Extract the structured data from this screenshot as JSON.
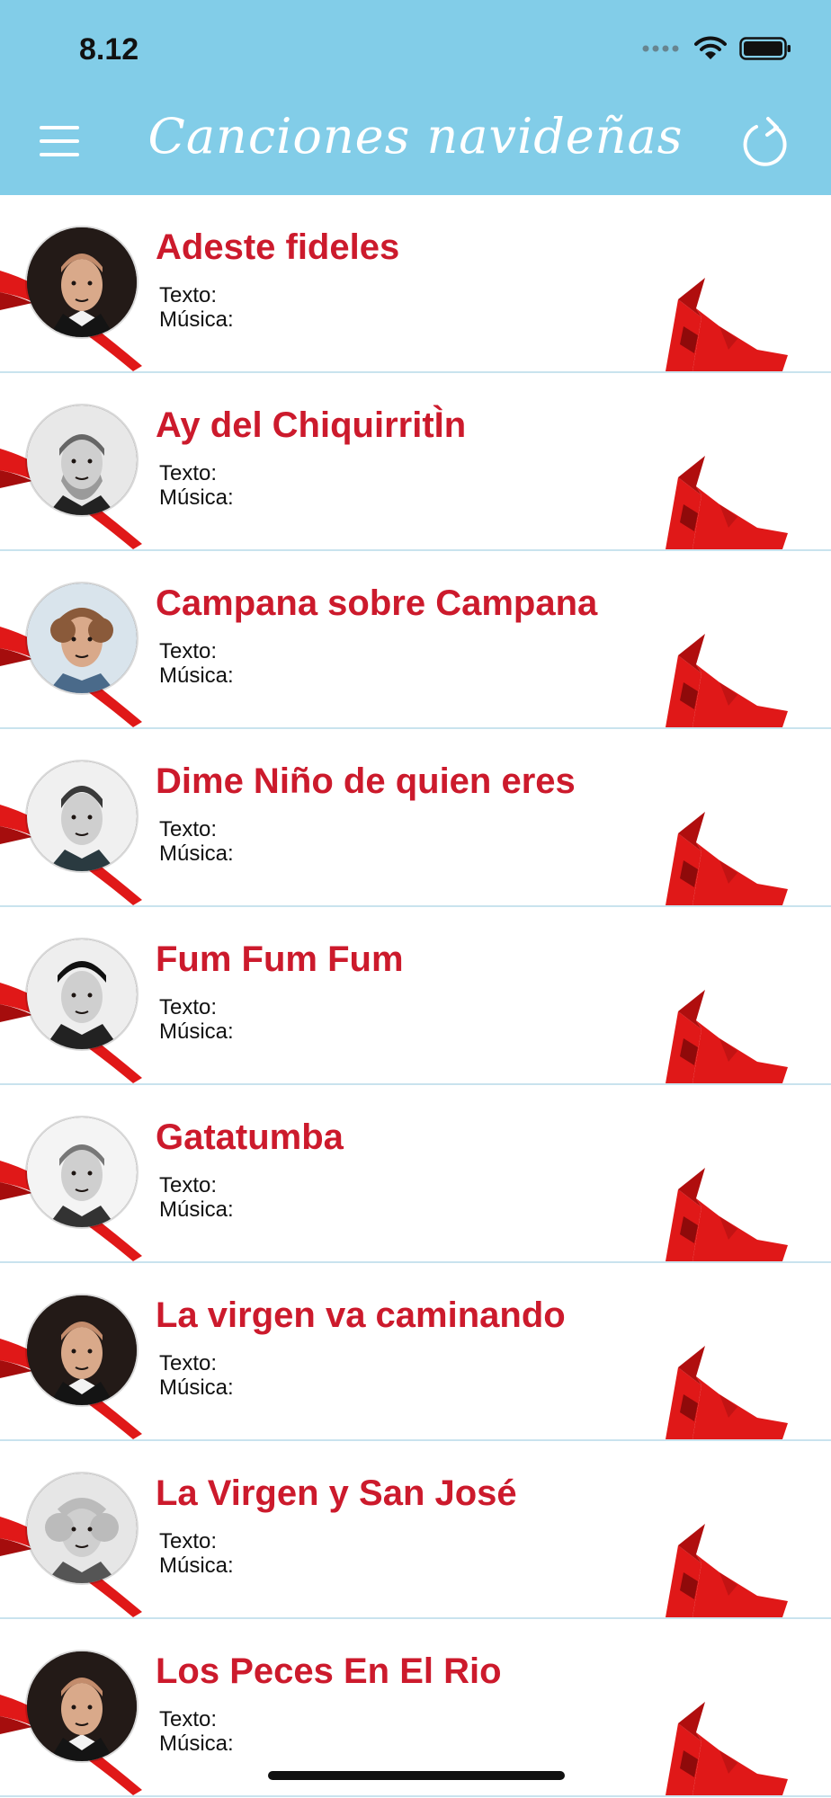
{
  "status_bar": {
    "time": "8.12"
  },
  "header": {
    "title": "Canciones navideñas"
  },
  "songs": [
    {
      "title": "Adeste fideles",
      "text_label": "Texto:",
      "music_label": "Música:",
      "portrait": "bald"
    },
    {
      "title": "Ay del ChiquirritÌn",
      "text_label": "Texto:",
      "music_label": "Música:",
      "portrait": "beard"
    },
    {
      "title": "Campana sobre Campana",
      "text_label": "Texto:",
      "music_label": "Música:",
      "portrait": "curly"
    },
    {
      "title": "Dime Niño de quien eres",
      "text_label": "Texto:",
      "music_label": "Música:",
      "portrait": "young"
    },
    {
      "title": "Fum Fum Fum",
      "text_label": "Texto:",
      "music_label": "Música:",
      "portrait": "cap"
    },
    {
      "title": "Gatatumba",
      "text_label": "Texto:",
      "music_label": "Música:",
      "portrait": "engraving"
    },
    {
      "title": "La virgen va caminando",
      "text_label": "Texto:",
      "music_label": "Música:",
      "portrait": "bald"
    },
    {
      "title": "La Virgen y San José",
      "text_label": "Texto:",
      "music_label": "Música:",
      "portrait": "wig"
    },
    {
      "title": "Los Peces En El Rio",
      "text_label": "Texto:",
      "music_label": "Música:",
      "portrait": "bald"
    }
  ],
  "colors": {
    "header": "#82cde8",
    "title_red": "#cc1a2c",
    "ribbon": "#e01818",
    "divider": "#c9e3ee"
  }
}
